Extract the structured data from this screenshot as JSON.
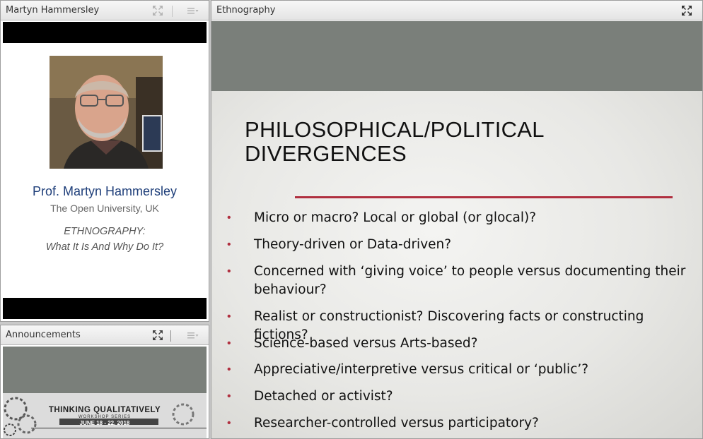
{
  "camera_pod": {
    "title": "Martyn Hammersley",
    "presenter_name": "Prof. Martyn Hammersley",
    "affiliation": "The Open University, UK",
    "talk_title": "ETHNOGRAPHY:",
    "talk_subtitle": "What It Is And Why Do It?"
  },
  "announcements_pod": {
    "title": "Announcements",
    "banner_title": "THINKING QUALITATIVELY",
    "banner_sub": "WORKSHOP SERIES",
    "banner_date": "JUNE 18 - 22, 2018"
  },
  "slide_pod": {
    "title": "Ethnography",
    "slide_heading_line1": "PHILOSOPHICAL/POLITICAL",
    "slide_heading_line2": "DIVERGENCES",
    "bullet_symbol": "•",
    "bullets": [
      "Micro or macro? Local or global (or glocal)?",
      "Theory-driven or Data-driven?",
      "Concerned with ‘giving voice’ to people versus documenting their behaviour?",
      "Realist or constructionist? Discovering facts or constructing fictions?",
      "Science-based versus Arts-based?",
      "Appreciative/interpretive versus critical or ‘public’?",
      "Detached or activist?",
      "Researcher-controlled versus participatory?"
    ]
  },
  "icons": {
    "fullscreen": "expand-icon",
    "pod_menu": "pod-menu-icon"
  },
  "colors": {
    "accent_red": "#b02f3f",
    "name_blue": "#1f3f7a",
    "slide_band": "#7a7f7a"
  }
}
